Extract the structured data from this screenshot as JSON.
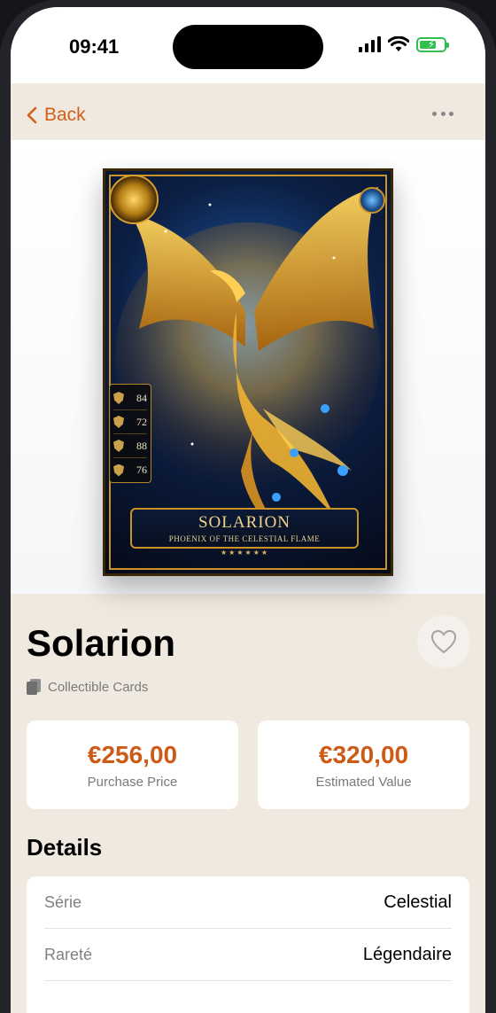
{
  "status_bar": {
    "time": "09:41"
  },
  "nav": {
    "back_label": "Back",
    "more_icon": "ellipsis-icon"
  },
  "card": {
    "name": "SOLARION",
    "subtitle": "PHOENIX OF THE CELESTIAL FLAME",
    "stars": "★★★★★★",
    "stats": [
      {
        "icon": "shield-icon",
        "value": "84"
      },
      {
        "icon": "shield-icon",
        "value": "72"
      },
      {
        "icon": "crown-icon",
        "value": "88"
      },
      {
        "icon": "flame-icon",
        "value": "76"
      }
    ]
  },
  "item": {
    "title": "Solarion",
    "category": "Collectible Cards",
    "favorite_icon": "heart-icon"
  },
  "prices": {
    "purchase": {
      "value": "€256,00",
      "label": "Purchase Price"
    },
    "estimated": {
      "value": "€320,00",
      "label": "Estimated Value"
    }
  },
  "details": {
    "heading": "Details",
    "rows": [
      {
        "label": "Série",
        "value": "Celestial"
      },
      {
        "label": "Rareté",
        "value": "Légendaire"
      }
    ]
  },
  "colors": {
    "accent": "#cc5b17",
    "background": "#efe9df",
    "battery": "#30c04f"
  }
}
